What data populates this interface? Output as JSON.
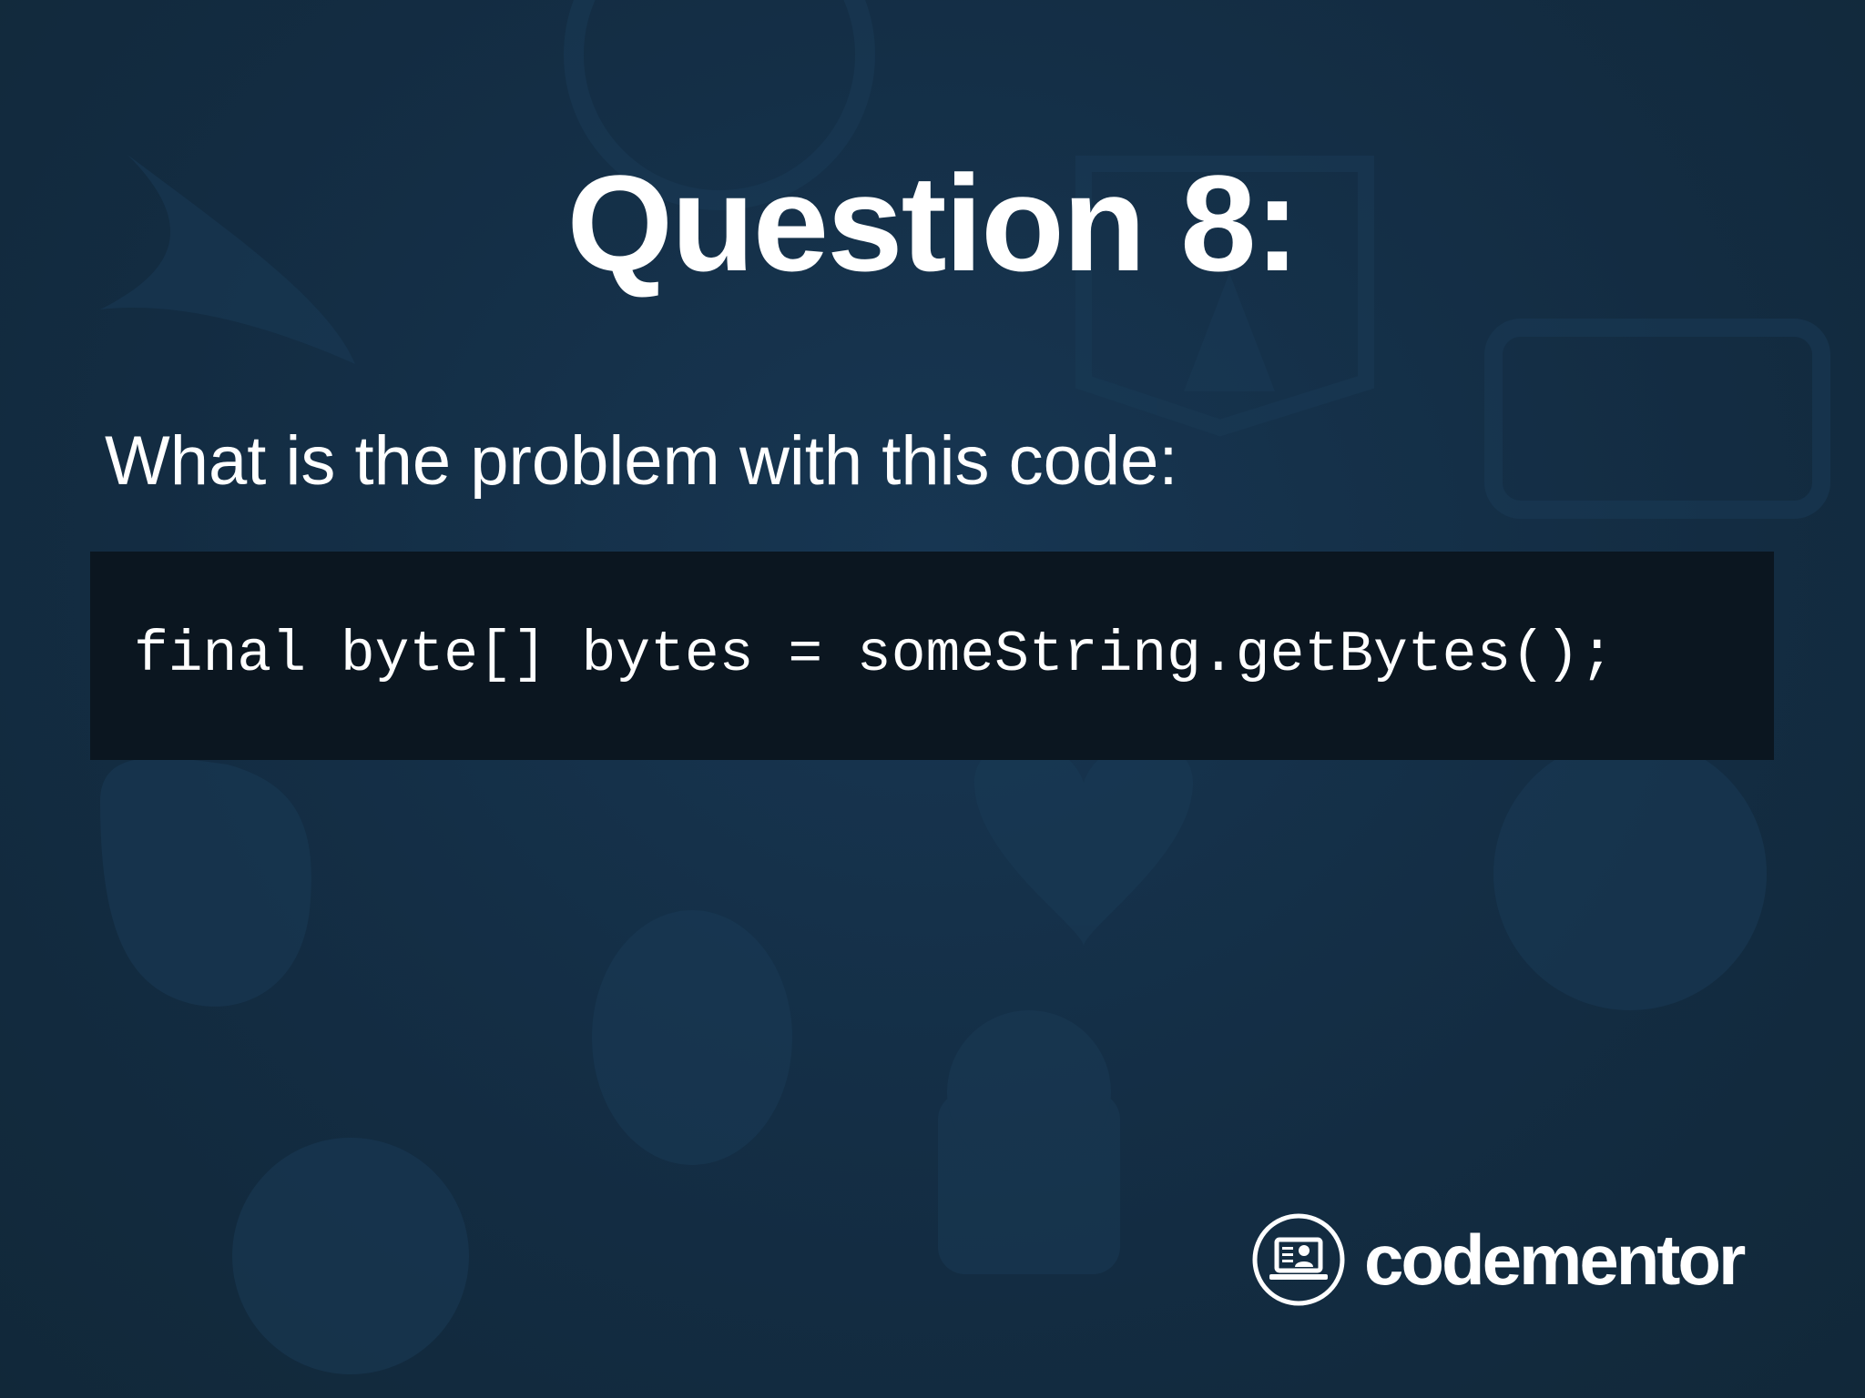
{
  "slide": {
    "title": "Question 8:",
    "prompt": "What is the problem with this code:",
    "code": "final byte[] bytes = someString.getBytes();"
  },
  "brand": {
    "name": "codementor",
    "logo_icon": "laptop-mentor-icon"
  },
  "colors": {
    "background": "#153047",
    "code_background": "#0b1620",
    "text": "#ffffff"
  }
}
